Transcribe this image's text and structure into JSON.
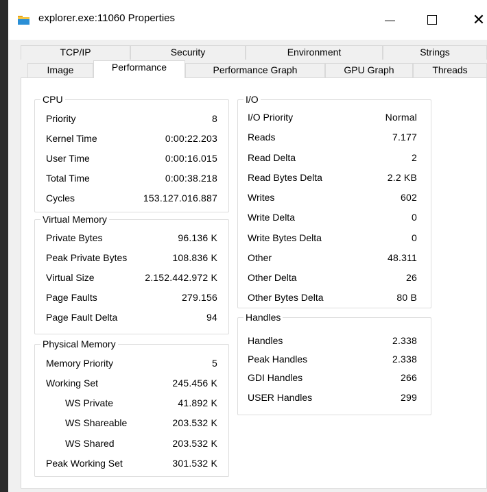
{
  "window": {
    "title": "explorer.exe:11060 Properties",
    "icon": "folder-icon",
    "minimize": "—",
    "maximize": "☐",
    "close": "✕"
  },
  "tabs_row1": [
    "TCP/IP",
    "Security",
    "Environment",
    "Strings"
  ],
  "tabs_row2": [
    "Image",
    "Performance",
    "Performance Graph",
    "GPU Graph",
    "Threads"
  ],
  "selected_tab": "Performance",
  "cpu": {
    "title": "CPU",
    "rows": [
      {
        "label": "Priority",
        "value": "8"
      },
      {
        "label": "Kernel Time",
        "value": "0:00:22.203"
      },
      {
        "label": "User Time",
        "value": "0:00:16.015"
      },
      {
        "label": "Total Time",
        "value": "0:00:38.218"
      },
      {
        "label": "Cycles",
        "value": "153.127.016.887"
      }
    ]
  },
  "virtual_memory": {
    "title": "Virtual Memory",
    "rows": [
      {
        "label": "Private Bytes",
        "value": "96.136 K"
      },
      {
        "label": "Peak Private Bytes",
        "value": "108.836 K"
      },
      {
        "label": "Virtual Size",
        "value": "2.152.442.972 K"
      },
      {
        "label": "Page Faults",
        "value": "279.156"
      },
      {
        "label": "Page Fault Delta",
        "value": "94"
      }
    ]
  },
  "physical_memory": {
    "title": "Physical Memory",
    "rows": [
      {
        "label": "Memory Priority",
        "value": "5"
      },
      {
        "label": "Working Set",
        "value": "245.456 K"
      },
      {
        "label": "WS Private",
        "value": "41.892 K"
      },
      {
        "label": "WS Shareable",
        "value": "203.532 K"
      },
      {
        "label": "WS Shared",
        "value": "203.532 K"
      },
      {
        "label": "Peak Working Set",
        "value": "301.532 K"
      }
    ]
  },
  "io": {
    "title": "I/O",
    "rows": [
      {
        "label": "I/O Priority",
        "value": "Normal"
      },
      {
        "label": "Reads",
        "value": "7.177"
      },
      {
        "label": "Read Delta",
        "value": "2"
      },
      {
        "label": "Read Bytes Delta",
        "value": "2.2  KB"
      },
      {
        "label": "Writes",
        "value": "602"
      },
      {
        "label": "Write Delta",
        "value": "0"
      },
      {
        "label": "Write Bytes Delta",
        "value": "0"
      },
      {
        "label": "Other",
        "value": "48.311"
      },
      {
        "label": "Other Delta",
        "value": "26"
      },
      {
        "label": "Other Bytes Delta",
        "value": "80 B"
      }
    ]
  },
  "handles": {
    "title": "Handles",
    "rows": [
      {
        "label": "Handles",
        "value": "2.338"
      },
      {
        "label": "Peak Handles",
        "value": "2.338"
      },
      {
        "label": "GDI Handles",
        "value": "266"
      },
      {
        "label": "USER Handles",
        "value": "299"
      }
    ]
  }
}
